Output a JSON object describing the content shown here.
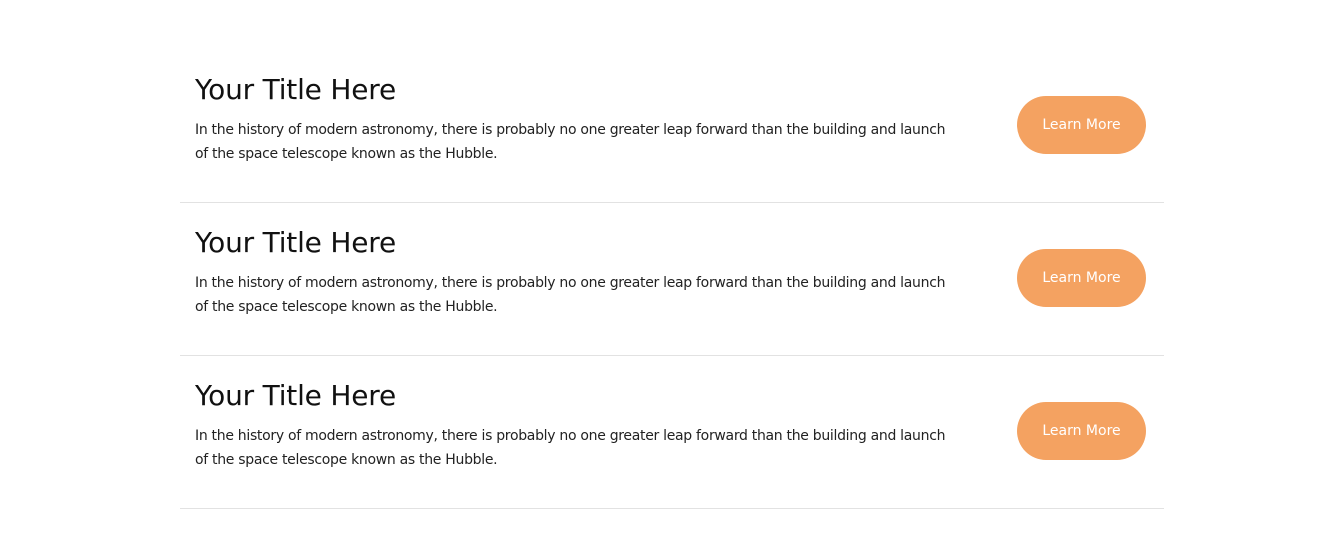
{
  "items": [
    {
      "title": "Your Title Here",
      "description": "In the history of modern astronomy, there is probably no one greater leap forward than the building and launch of the space telescope known as the Hubble.",
      "button_label": "Learn More"
    },
    {
      "title": "Your Title Here",
      "description": "In the history of modern astronomy, there is probably no one greater leap forward than the building and launch of the space telescope known as the Hubble.",
      "button_label": "Learn More"
    },
    {
      "title": "Your Title Here",
      "description": "In the history of modern astronomy, there is probably no one greater leap forward than the building and launch of the space telescope known as the Hubble.",
      "button_label": "Learn More"
    }
  ],
  "colors": {
    "button_background": "#f4a261",
    "button_text": "#ffffff",
    "divider": "#e2e2e2"
  }
}
